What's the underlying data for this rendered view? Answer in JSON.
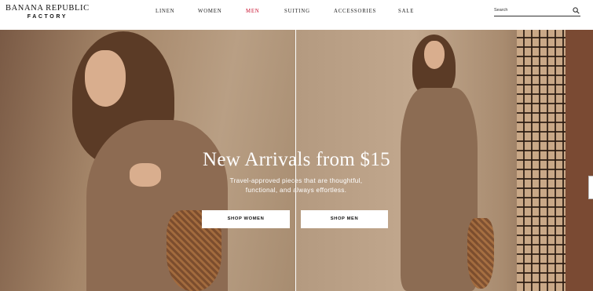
{
  "brand": {
    "line1": "BANANA REPUBLIC",
    "line2": "FACTORY"
  },
  "nav": {
    "items": [
      {
        "label": "LINEN"
      },
      {
        "label": "WOMEN"
      },
      {
        "label": "MEN",
        "color": "#c8102e"
      },
      {
        "label": "SUITING"
      },
      {
        "label": "ACCESSORIES"
      },
      {
        "label": "SALE"
      }
    ]
  },
  "search": {
    "placeholder": "Search",
    "icon": "search-icon"
  },
  "hero": {
    "headline": "New Arrivals from $15",
    "subtext": "Travel-approved pieces that are thoughtful, functional, and always effortless.",
    "buttons": [
      {
        "label": "SHOP WOMEN"
      },
      {
        "label": "SHOP MEN"
      }
    ]
  },
  "colors": {
    "accent": "#c8102e",
    "text": "#111111",
    "button_bg": "#ffffff"
  }
}
